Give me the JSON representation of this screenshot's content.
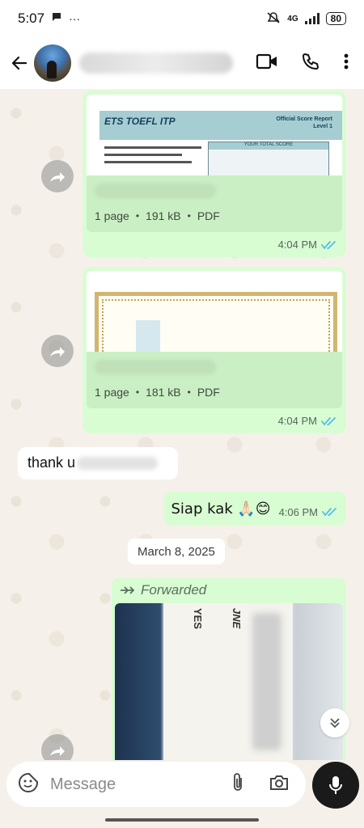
{
  "status_bar": {
    "time": "5:07",
    "network": "4G",
    "battery": "80"
  },
  "header": {
    "contact_name_hidden": ""
  },
  "messages": {
    "doc1": {
      "preview_logo": "ETS TOEFL ITP",
      "preview_title_line1": "Official Score Report",
      "preview_title_line2": "Level 1",
      "preview_box_label": "YOUR TOTAL SCORE",
      "pages": "1 page",
      "size": "191 kB",
      "type": "PDF",
      "time": "4:04 PM"
    },
    "doc2": {
      "pages": "1 page",
      "size": "181 kB",
      "type": "PDF",
      "time": "4:04 PM"
    },
    "incoming1": {
      "text": "thank u"
    },
    "outgoing1": {
      "text": "Siap kak 🙏🏻😊",
      "time": "4:06 PM"
    },
    "date_divider": "March 8, 2025",
    "forwarded": {
      "label": "Forwarded",
      "photo_text_yes": "YES",
      "photo_text_jne": "JNE"
    }
  },
  "composer": {
    "placeholder": "Message"
  },
  "colors": {
    "bubble_out": "#d9fdd3",
    "bubble_in": "#ffffff",
    "read_ticks": "#53bdeb",
    "chat_bg": "#f5f1ea"
  }
}
